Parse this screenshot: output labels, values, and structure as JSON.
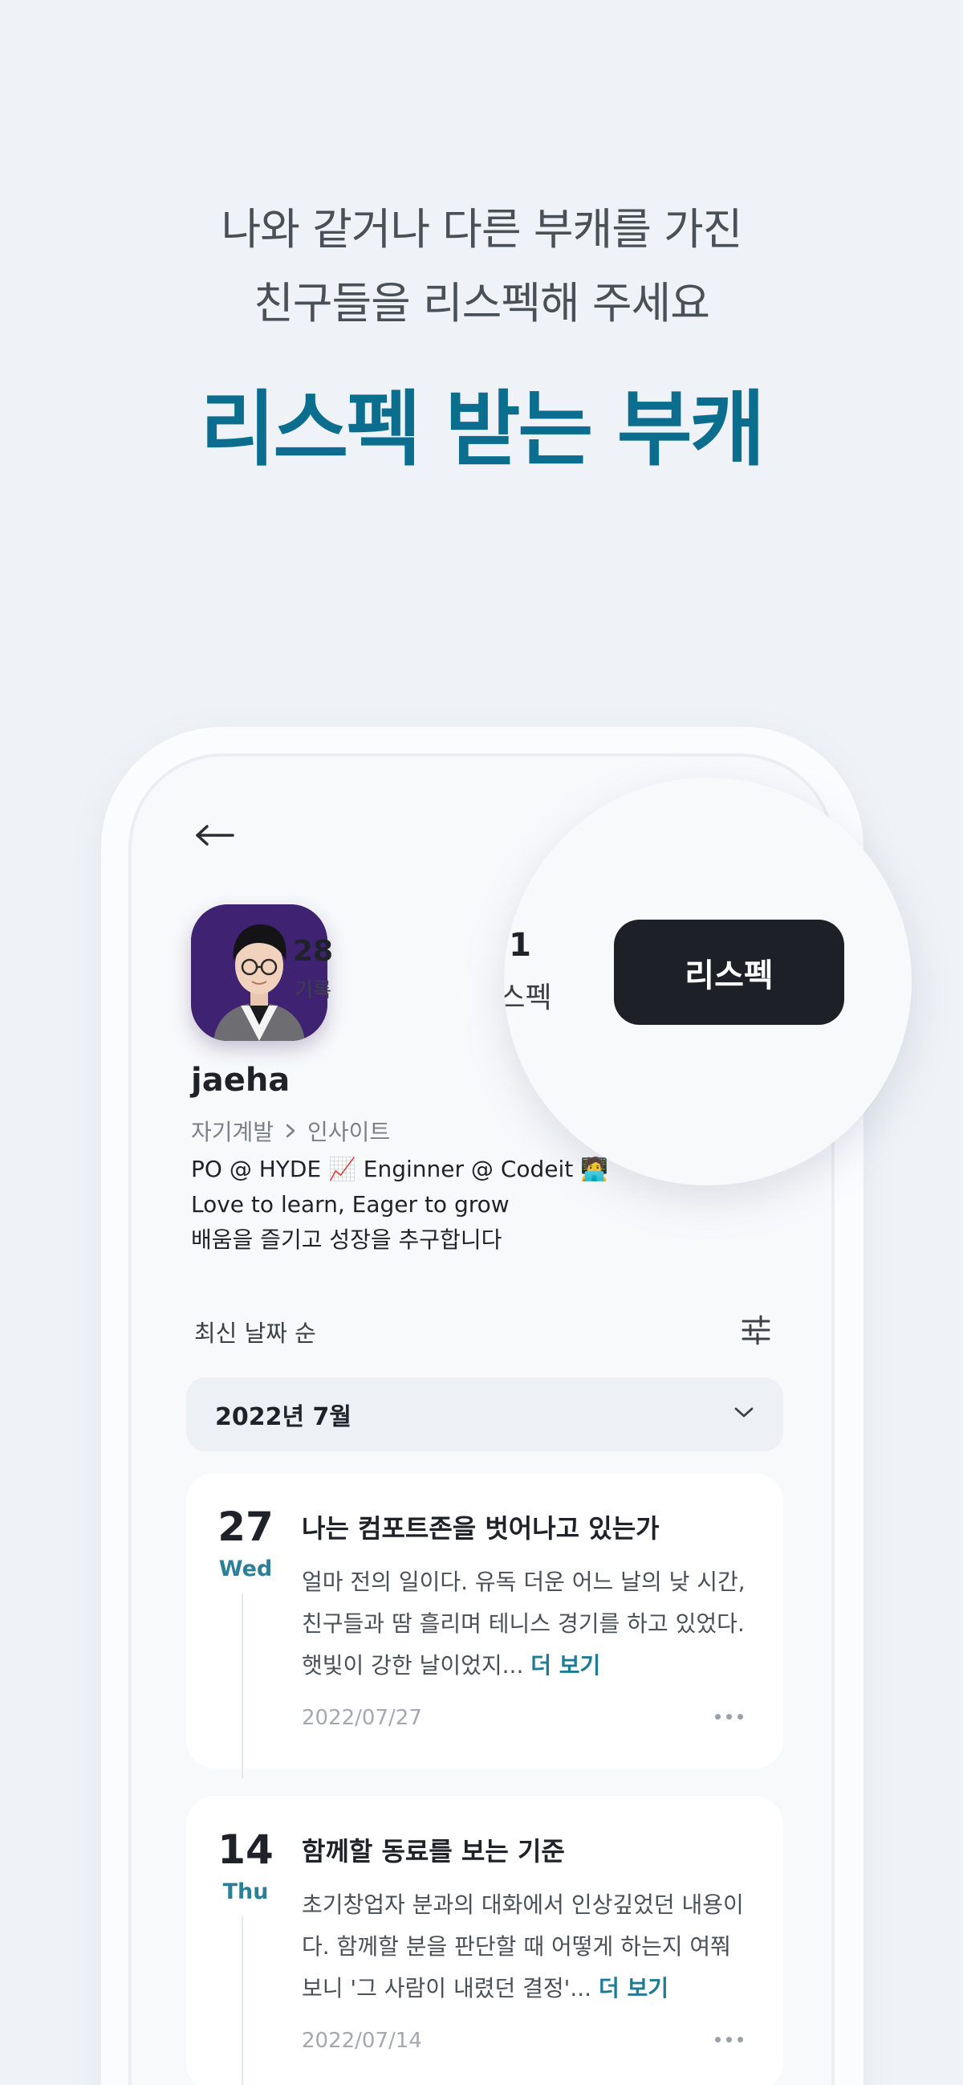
{
  "promo": {
    "subtitle_line1": "나와 같거나 다른 부캐를 가진",
    "subtitle_line2": "친구들을 리스펙해 주세요",
    "title": "리스펙 받는 부캐"
  },
  "profile": {
    "username": "jaeha",
    "category": "자기계발",
    "subcategory": "인사이트",
    "bio_line1": "PO @ HYDE 📈 Enginner @ Codeit 🧑‍💻",
    "bio_line2": "Love to learn, Eager to grow",
    "bio_line3": "배움을 즐기고 성장을 추구합니다",
    "stats": {
      "records_count": "28",
      "records_label": "기록",
      "respect_count": "1",
      "respect_label": "리스펙"
    },
    "respect_button_label": "리스펙"
  },
  "feed": {
    "sort_label": "최신 날짜 순",
    "month": "2022년 7월",
    "posts": [
      {
        "day": "27",
        "weekday": "Wed",
        "title": "나는 컴포트존을 벗어나고 있는가",
        "excerpt_line1": "얼마 전의 일이다. 유독 더운 어느 날의 낮 시간,",
        "excerpt_line2": "친구들과 땀 흘리며 테니스 경기를 하고 있었다.",
        "excerpt_line3": "햇빛이 강한 날이었지...",
        "more_label": "더 보기",
        "date": "2022/07/27"
      },
      {
        "day": "14",
        "weekday": "Thu",
        "title": "함께할 동료를 보는 기준",
        "excerpt_line1": "초기창업자 분과의 대화에서 인상깊었던 내용이",
        "excerpt_line2": "다. 함께할 분을 판단할 때 어떻게 하는지 여쭤",
        "excerpt_line3": "보니 '그 사람이 내렸던 결정'...",
        "more_label": "더 보기",
        "date": "2022/07/14"
      }
    ]
  },
  "colors": {
    "accent": "#0b6e8f",
    "button_dark": "#1d2027",
    "avatar_bg": "#3f2271"
  }
}
